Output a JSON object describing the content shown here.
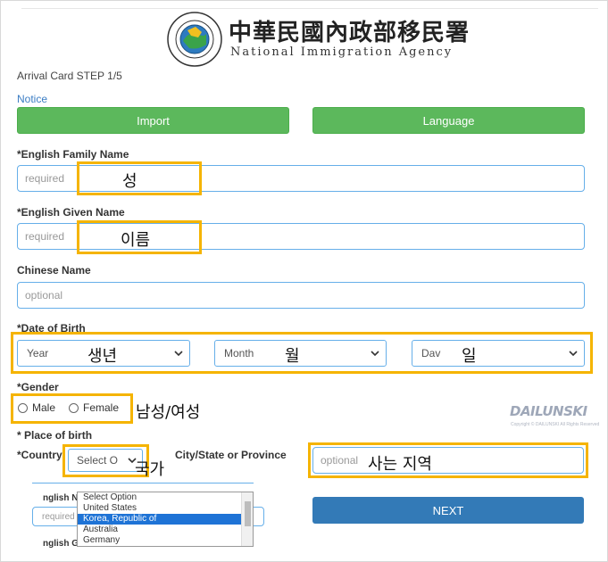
{
  "header": {
    "title_zh": "中華民國內政部移民署",
    "title_en": "National Immigration Agency",
    "logo_text": "National Immigration Agency"
  },
  "form": {
    "step": "Arrival Card STEP 1/5",
    "notice_link": "Notice",
    "buttons": {
      "import": "Import",
      "language": "Language",
      "next": "NEXT"
    },
    "family_name": {
      "label": "*English Family Name",
      "placeholder": "required",
      "annotation": "성"
    },
    "given_name": {
      "label": "*English Given Name",
      "placeholder": "required",
      "annotation": "이름"
    },
    "chinese_name": {
      "label": "Chinese Name",
      "placeholder": "optional"
    },
    "dob": {
      "label": "*Date of Birth",
      "year": "Year",
      "month": "Month",
      "day": "Dav",
      "annotations": {
        "year": "생년",
        "month": "월",
        "day": "일"
      }
    },
    "gender": {
      "label": "*Gender",
      "male": "Male",
      "female": "Female",
      "annotation": "남성/여성"
    },
    "place_of_birth": {
      "label": "* Place of birth",
      "country_label": "*Country",
      "country_value": "Select O",
      "country_annotation": "국가",
      "city_label": "City/State or Province",
      "city_placeholder": "optional",
      "city_annotation": "사는 지역"
    },
    "country_options": [
      "Select Option",
      "United States",
      "Korea, Republic of",
      "Australia",
      "Germany"
    ],
    "selected_country": "Korea, Republic of",
    "partial_labels": {
      "row1": "nglish N",
      "row1_placeholder": "required",
      "row2": "nglish G"
    }
  },
  "watermark": {
    "text": "DAILUNSKI",
    "sub": "Copyright © DAILUNSKI All Rights Reserved"
  },
  "colors": {
    "green": "#5cb85c",
    "blue": "#337ab7",
    "highlight": "#f5b400",
    "border": "#66afe9"
  }
}
